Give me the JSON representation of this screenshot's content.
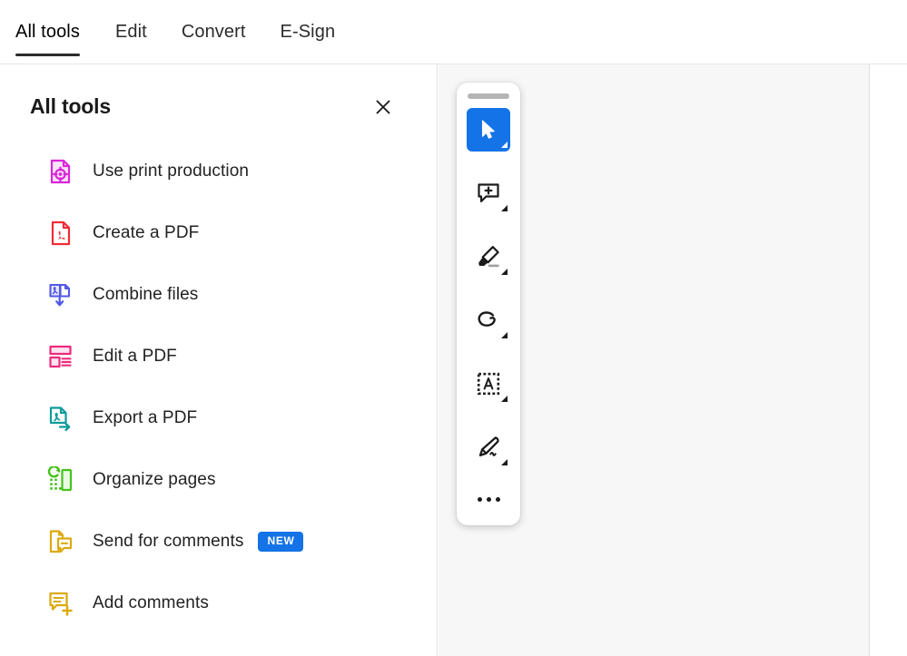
{
  "tabbar": {
    "tabs": [
      {
        "label": "All tools",
        "active": true
      },
      {
        "label": "Edit",
        "active": false
      },
      {
        "label": "Convert",
        "active": false
      },
      {
        "label": "E-Sign",
        "active": false
      }
    ]
  },
  "panel": {
    "title": "All tools",
    "close_icon": "close-icon",
    "tools": [
      {
        "label": "Use print production",
        "icon": "print-production-icon",
        "color": "#d926d9"
      },
      {
        "label": "Create a PDF",
        "icon": "create-pdf-icon",
        "color": "#f02b36"
      },
      {
        "label": "Combine files",
        "icon": "combine-files-icon",
        "color": "#5258e4"
      },
      {
        "label": "Edit a PDF",
        "icon": "edit-pdf-icon",
        "color": "#ee2a7b"
      },
      {
        "label": "Export a PDF",
        "icon": "export-pdf-icon",
        "color": "#0f9b9b"
      },
      {
        "label": "Organize pages",
        "icon": "organize-pages-icon",
        "color": "#44c21b"
      },
      {
        "label": "Send for comments",
        "icon": "send-for-comments-icon",
        "color": "#dcaa10",
        "badge": "NEW"
      },
      {
        "label": "Add comments",
        "icon": "add-comments-icon",
        "color": "#dcaa10"
      }
    ]
  },
  "quick_toolbar": {
    "drag_handle": "drag-handle",
    "tools": [
      {
        "name": "select-tool",
        "icon": "cursor-arrow-icon",
        "selected": true,
        "has_caret": true
      },
      {
        "name": "add-comment-tool",
        "icon": "comment-plus-icon",
        "selected": false,
        "has_caret": true
      },
      {
        "name": "highlight-tool",
        "icon": "highlighter-icon",
        "selected": false,
        "has_caret": true
      },
      {
        "name": "draw-tool",
        "icon": "lasso-draw-icon",
        "selected": false,
        "has_caret": true
      },
      {
        "name": "text-select-tool",
        "icon": "text-box-icon",
        "selected": false,
        "has_caret": true
      },
      {
        "name": "sign-tool",
        "icon": "fountain-pen-icon",
        "selected": false,
        "has_caret": true
      }
    ],
    "more_label": "more-options"
  },
  "colors": {
    "accent_blue": "#1473e6",
    "badge_blue": "#1473e6",
    "tab_underline": "#2c2c2c",
    "doc_background": "#f7f7f7"
  }
}
